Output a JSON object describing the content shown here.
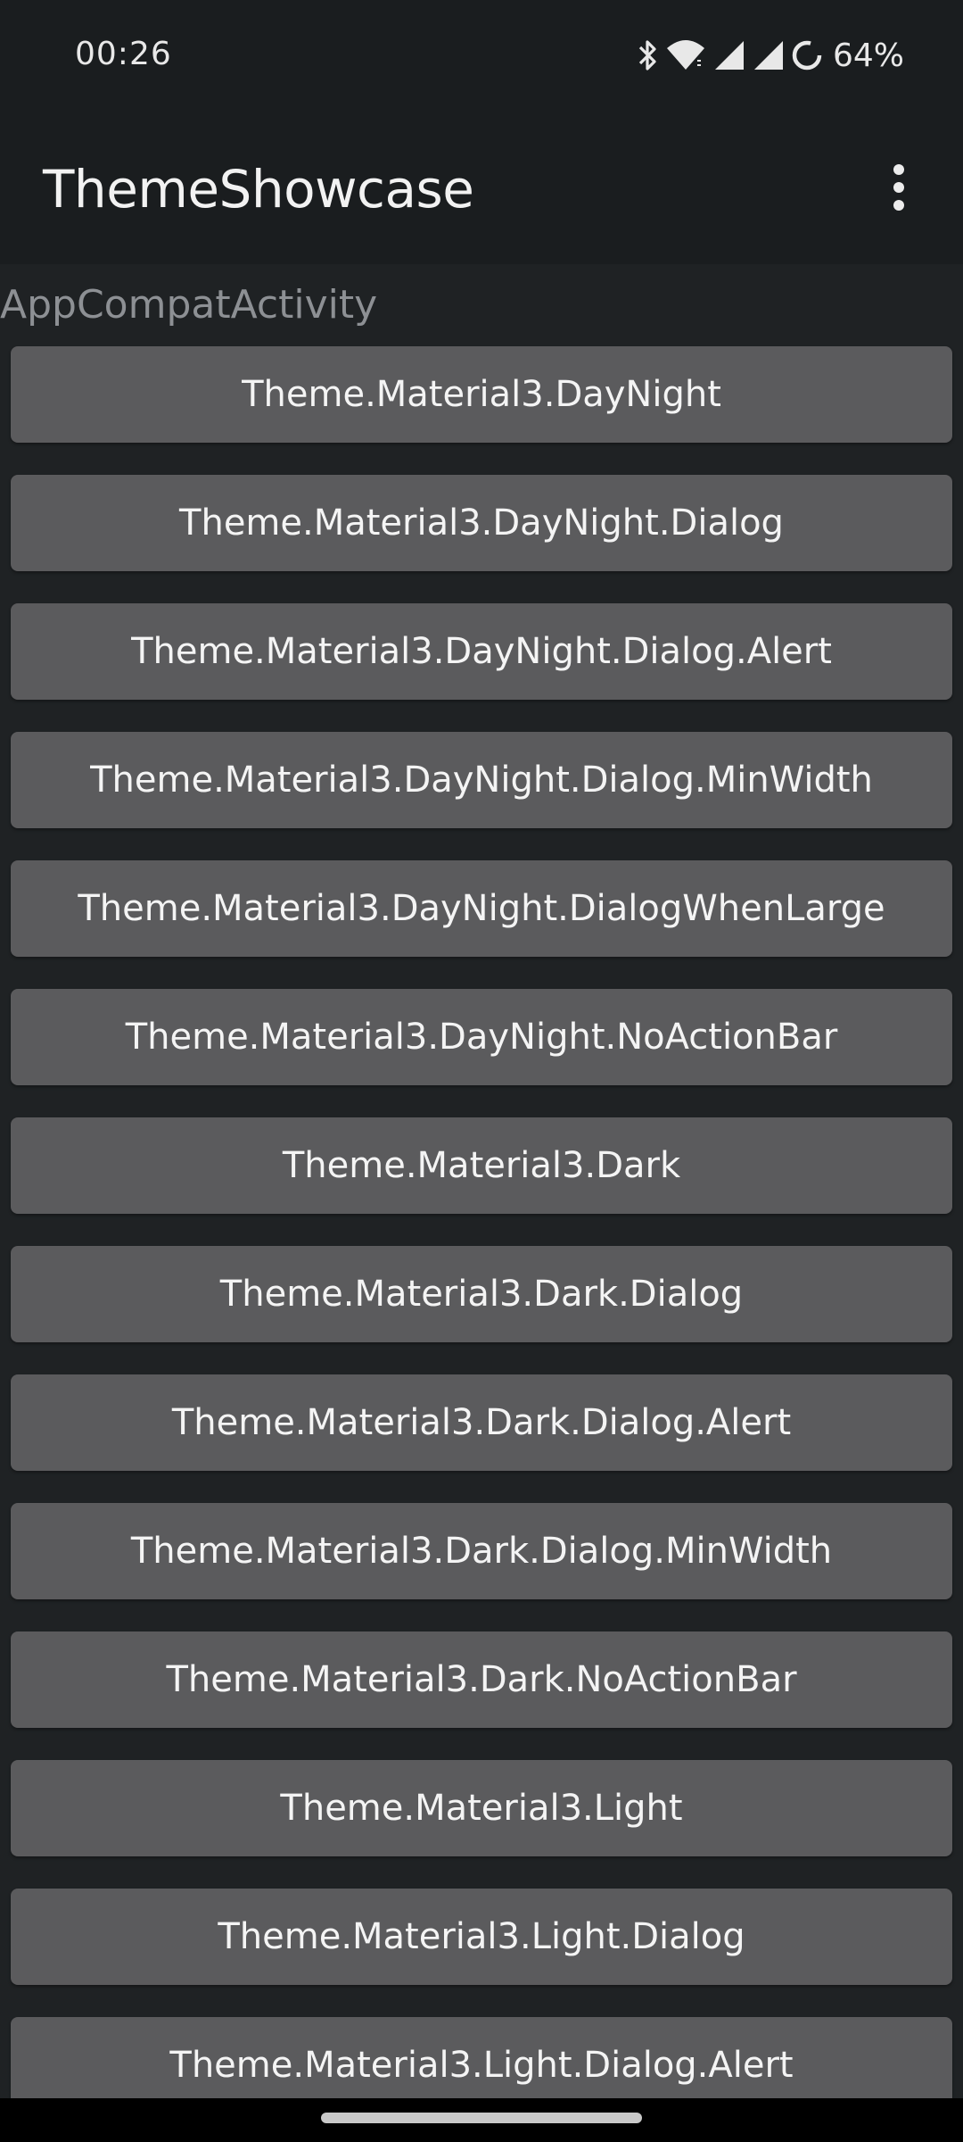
{
  "status_bar": {
    "time": "00:26",
    "battery": "64%",
    "icons": [
      "bluetooth-icon",
      "wifi-icon",
      "signal-icon",
      "signal-icon",
      "battery-saver-ring-icon"
    ]
  },
  "app_bar": {
    "title": "ThemeShowcase",
    "overflow_icon": "more-vert-icon"
  },
  "section": {
    "header": "AppCompatActivity"
  },
  "themes": [
    "Theme.Material3.DayNight",
    "Theme.Material3.DayNight.Dialog",
    "Theme.Material3.DayNight.Dialog.Alert",
    "Theme.Material3.DayNight.Dialog.MinWidth",
    "Theme.Material3.DayNight.DialogWhenLarge",
    "Theme.Material3.DayNight.NoActionBar",
    "Theme.Material3.Dark",
    "Theme.Material3.Dark.Dialog",
    "Theme.Material3.Dark.Dialog.Alert",
    "Theme.Material3.Dark.Dialog.MinWidth",
    "Theme.Material3.Dark.NoActionBar",
    "Theme.Material3.Light",
    "Theme.Material3.Light.Dialog",
    "Theme.Material3.Light.Dialog.Alert"
  ],
  "colors": {
    "background": "#1a1d1f",
    "content_background": "#1f2224",
    "button": "#5b5b5d",
    "section_header": "#8d9094"
  }
}
